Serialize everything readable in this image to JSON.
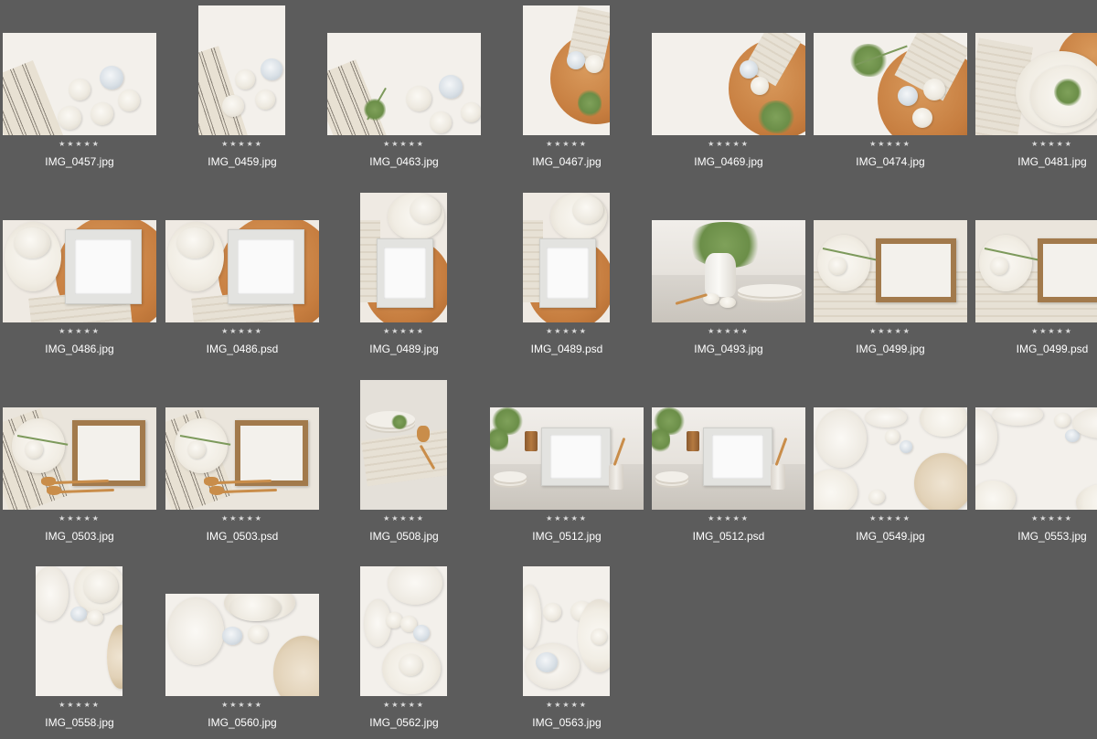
{
  "rating_glyphs": "★★★★★",
  "rows": [
    [
      {
        "filename": "IMG_0457.jpg",
        "orientation": "landscape"
      },
      {
        "filename": "IMG_0459.jpg",
        "orientation": "portrait"
      },
      {
        "filename": "IMG_0463.jpg",
        "orientation": "landscape"
      },
      {
        "filename": "IMG_0467.jpg",
        "orientation": "portrait"
      },
      {
        "filename": "IMG_0469.jpg",
        "orientation": "landscape"
      },
      {
        "filename": "IMG_0474.jpg",
        "orientation": "landscape"
      },
      {
        "filename": "IMG_0481.jpg",
        "orientation": "landscape"
      }
    ],
    [
      {
        "filename": "IMG_0486.jpg",
        "orientation": "landscape"
      },
      {
        "filename": "IMG_0486.psd",
        "orientation": "landscape"
      },
      {
        "filename": "IMG_0489.jpg",
        "orientation": "portrait"
      },
      {
        "filename": "IMG_0489.psd",
        "orientation": "portrait"
      },
      {
        "filename": "IMG_0493.jpg",
        "orientation": "landscape"
      },
      {
        "filename": "IMG_0499.jpg",
        "orientation": "landscape"
      },
      {
        "filename": "IMG_0499.psd",
        "orientation": "landscape"
      }
    ],
    [
      {
        "filename": "IMG_0503.jpg",
        "orientation": "landscape"
      },
      {
        "filename": "IMG_0503.psd",
        "orientation": "landscape"
      },
      {
        "filename": "IMG_0508.jpg",
        "orientation": "portrait"
      },
      {
        "filename": "IMG_0512.jpg",
        "orientation": "landscape"
      },
      {
        "filename": "IMG_0512.psd",
        "orientation": "landscape"
      },
      {
        "filename": "IMG_0549.jpg",
        "orientation": "landscape"
      },
      {
        "filename": "IMG_0553.jpg",
        "orientation": "landscape"
      }
    ],
    [
      {
        "filename": "IMG_0558.jpg",
        "orientation": "portrait"
      },
      {
        "filename": "IMG_0560.jpg",
        "orientation": "landscape"
      },
      {
        "filename": "IMG_0562.jpg",
        "orientation": "portrait"
      },
      {
        "filename": "IMG_0563.jpg",
        "orientation": "portrait"
      }
    ]
  ],
  "colors": {
    "background": "#5c5c5c",
    "filename_text": "#ffffff",
    "stars": "#dcdcdc"
  }
}
